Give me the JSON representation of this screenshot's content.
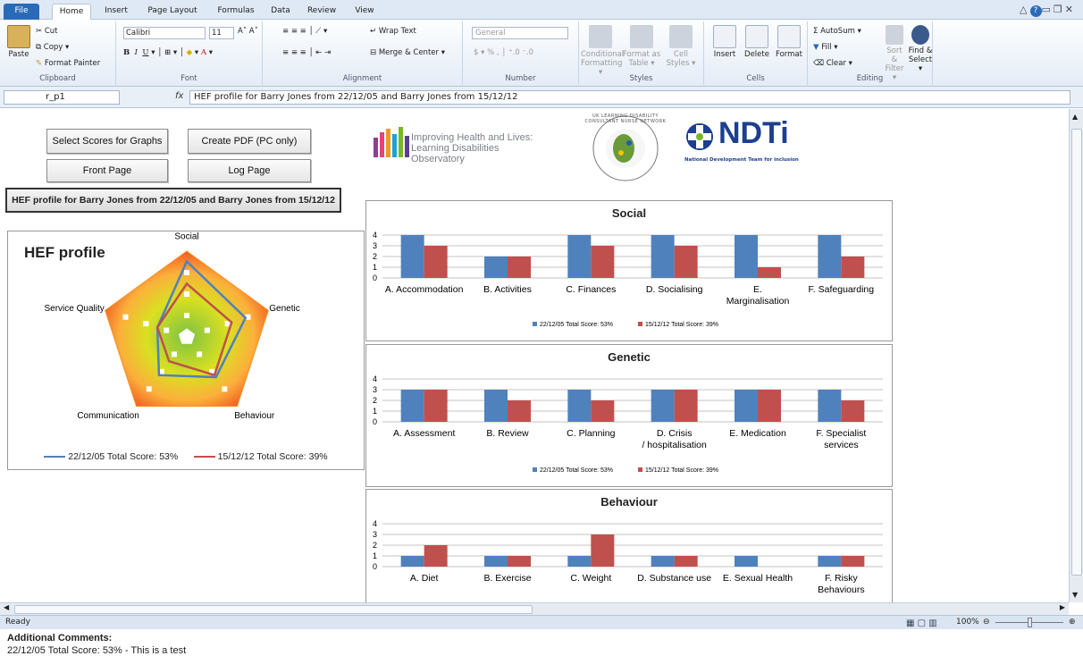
{
  "tabs": [
    "File",
    "Home",
    "Insert",
    "Page Layout",
    "Formulas",
    "Data",
    "Review",
    "View"
  ],
  "ribbon": {
    "clipboard": {
      "paste": "Paste",
      "cut": "Cut",
      "copy": "Copy ▾",
      "format_painter": "Format Painter",
      "label": "Clipboard"
    },
    "font": {
      "name": "Calibri",
      "size": "11",
      "label": "Font"
    },
    "alignment": {
      "wrap": "Wrap Text",
      "merge": "Merge & Center ▾",
      "label": "Alignment"
    },
    "number": {
      "format": "General",
      "label": "Number"
    },
    "styles": {
      "conditional": "Conditional Formatting ▾",
      "format_table": "Format as Table ▾",
      "cell_styles": "Cell Styles ▾",
      "label": "Styles"
    },
    "cells": {
      "insert": "Insert",
      "delete": "Delete",
      "format": "Format",
      "label": "Cells"
    },
    "editing": {
      "autosum": "Σ AutoSum ▾",
      "fill": "Fill ▾",
      "clear": "Clear ▾",
      "sort": "Sort & Filter ▾",
      "find": "Find & Select ▾",
      "label": "Editing"
    }
  },
  "formula_bar": {
    "name_box": "r_p1",
    "fx": "fx",
    "content": "HEF profile for Barry Jones from 22/12/05 and Barry Jones from 15/12/12"
  },
  "buttons": {
    "select_scores": "Select Scores for Graphs",
    "create_pdf": "Create PDF (PC only)",
    "front_page": "Front Page",
    "log_page": "Log Page"
  },
  "profile_title": "HEF profile for Barry Jones from 22/12/05 and Barry Jones from 15/12/12",
  "logos": {
    "ihal_line1": "Improving Health and Lives:",
    "ihal_line2": "Learning Disabilities Observatory",
    "ndti_name": "NDTi",
    "ndti_sub": "National Development Team for inclusion",
    "seal_text": "UK LEARNING DISABILITY CONSULTANT NURSE NETWORK"
  },
  "radar": {
    "title": "HEF profile",
    "axes": [
      "Social",
      "Genetic",
      "Behaviour",
      "Communication",
      "Service Quality"
    ],
    "series": [
      {
        "name": "22/12/05 Total Score: 53%",
        "color": "#4f81bd",
        "values": [
          0.88,
          0.72,
          0.58,
          0.55,
          0.36
        ]
      },
      {
        "name": "15/12/12 Total Score: 39%",
        "color": "#c0504d",
        "values": [
          0.62,
          0.55,
          0.55,
          0.35,
          0.36
        ]
      }
    ]
  },
  "chart_data": [
    {
      "type": "bar",
      "title": "Social",
      "categories": [
        "A. Accommodation",
        "B. Activities",
        "C. Finances",
        "D. Socialising",
        "E. Marginalisation",
        "F. Safeguarding"
      ],
      "series": [
        {
          "name": "22/12/05 Total Score: 53%",
          "color": "#4f81bd",
          "values": [
            4,
            2,
            4,
            4,
            4,
            4
          ]
        },
        {
          "name": "15/12/12 Total Score: 39%",
          "color": "#c0504d",
          "values": [
            3,
            2,
            3,
            3,
            1,
            2
          ]
        }
      ],
      "ylim": [
        0,
        4
      ]
    },
    {
      "type": "bar",
      "title": "Genetic",
      "categories": [
        "A. Assessment",
        "B. Review",
        "C. Planning",
        "D. Crisis / hospitalisation",
        "E. Medication",
        "F. Specialist services"
      ],
      "series": [
        {
          "name": "22/12/05 Total Score: 53%",
          "color": "#4f81bd",
          "values": [
            3,
            3,
            3,
            3,
            3,
            3
          ]
        },
        {
          "name": "15/12/12 Total Score: 39%",
          "color": "#c0504d",
          "values": [
            3,
            2,
            2,
            3,
            3,
            2
          ]
        }
      ],
      "ylim": [
        0,
        4
      ]
    },
    {
      "type": "bar",
      "title": "Behaviour",
      "categories": [
        "A. Diet",
        "B. Exercise",
        "C. Weight",
        "D. Substance use",
        "E. Sexual Health",
        "F. Risky Behaviours"
      ],
      "series": [
        {
          "name": "22/12/05 Total Score: 53%",
          "color": "#4f81bd",
          "values": [
            1,
            1,
            1,
            1,
            1,
            1
          ]
        },
        {
          "name": "15/12/12 Total Score: 39%",
          "color": "#c0504d",
          "values": [
            2,
            1,
            3,
            1,
            0,
            1
          ]
        }
      ],
      "ylim": [
        0,
        4
      ]
    }
  ],
  "comments": {
    "heading": "Additional Comments:",
    "text": "22/12/05 Total Score: 53% - This is a test"
  },
  "status": {
    "ready": "Ready",
    "zoom": "100%"
  }
}
